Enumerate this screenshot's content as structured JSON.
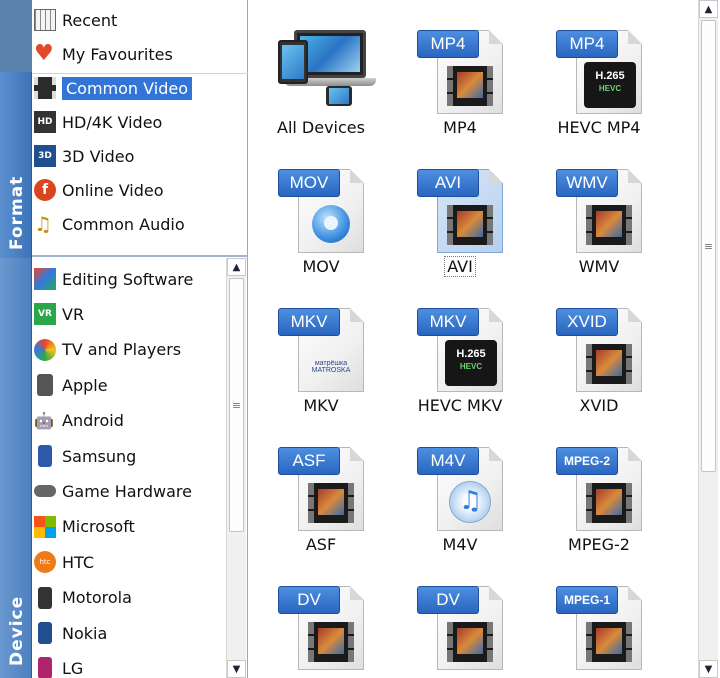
{
  "sidebar_tabs": {
    "format": "Format",
    "device": "Device"
  },
  "format_categories": [
    {
      "label": "Recent",
      "icon": "calendar-grid-icon"
    },
    {
      "label": "My Favourites",
      "icon": "heart-icon"
    },
    {
      "label": "Common Video",
      "icon": "film-strip-icon",
      "selected": true
    },
    {
      "label": "HD/4K Video",
      "icon": "hd-icon"
    },
    {
      "label": "3D Video",
      "icon": "3d-icon"
    },
    {
      "label": "Online Video",
      "icon": "online-video-icon"
    },
    {
      "label": "Common Audio",
      "icon": "music-note-icon"
    }
  ],
  "device_categories": [
    {
      "label": "Editing Software",
      "icon": "editing-software-icon"
    },
    {
      "label": "VR",
      "icon": "vr-icon"
    },
    {
      "label": "TV and Players",
      "icon": "tv-icon"
    },
    {
      "label": "Apple",
      "icon": "apple-device-icon"
    },
    {
      "label": "Android",
      "icon": "android-icon"
    },
    {
      "label": "Samsung",
      "icon": "samsung-phone-icon"
    },
    {
      "label": "Game Hardware",
      "icon": "gamepad-icon"
    },
    {
      "label": "Microsoft",
      "icon": "microsoft-logo-icon"
    },
    {
      "label": "HTC",
      "icon": "htc-icon"
    },
    {
      "label": "Motorola",
      "icon": "motorola-phone-icon"
    },
    {
      "label": "Nokia",
      "icon": "nokia-phone-icon"
    },
    {
      "label": "LG",
      "icon": "lg-phone-icon"
    }
  ],
  "formats": [
    {
      "label": "All Devices",
      "badge": "",
      "kind": "devices"
    },
    {
      "label": "MP4",
      "badge": "MP4",
      "kind": "film"
    },
    {
      "label": "HEVC MP4",
      "badge": "MP4",
      "kind": "hevc"
    },
    {
      "label": "MOV",
      "badge": "MOV",
      "kind": "quicktime"
    },
    {
      "label": "AVI",
      "badge": "AVI",
      "kind": "film",
      "selected": true
    },
    {
      "label": "WMV",
      "badge": "WMV",
      "kind": "film"
    },
    {
      "label": "MKV",
      "badge": "MKV",
      "kind": "matroska"
    },
    {
      "label": "HEVC MKV",
      "badge": "MKV",
      "kind": "hevc"
    },
    {
      "label": "XVID",
      "badge": "XVID",
      "kind": "film"
    },
    {
      "label": "ASF",
      "badge": "ASF",
      "kind": "film"
    },
    {
      "label": "M4V",
      "badge": "M4V",
      "kind": "itunes"
    },
    {
      "label": "MPEG-2",
      "badge": "MPEG-2",
      "kind": "film"
    },
    {
      "label": "",
      "badge": "DV",
      "kind": "film"
    },
    {
      "label": "",
      "badge": "DV",
      "kind": "film"
    },
    {
      "label": "",
      "badge": "MPEG-1",
      "kind": "film"
    }
  ],
  "hevc_text": {
    "main": "H.265",
    "sub": "HEVC"
  },
  "matroska_text": "матрёшка MATROSKA",
  "scroll": {
    "up": "▲",
    "down": "▼",
    "grip": "≡"
  },
  "colors": {
    "accent": "#3375d6",
    "tab": "#4a7fc0",
    "badge": "#2a66c0"
  }
}
